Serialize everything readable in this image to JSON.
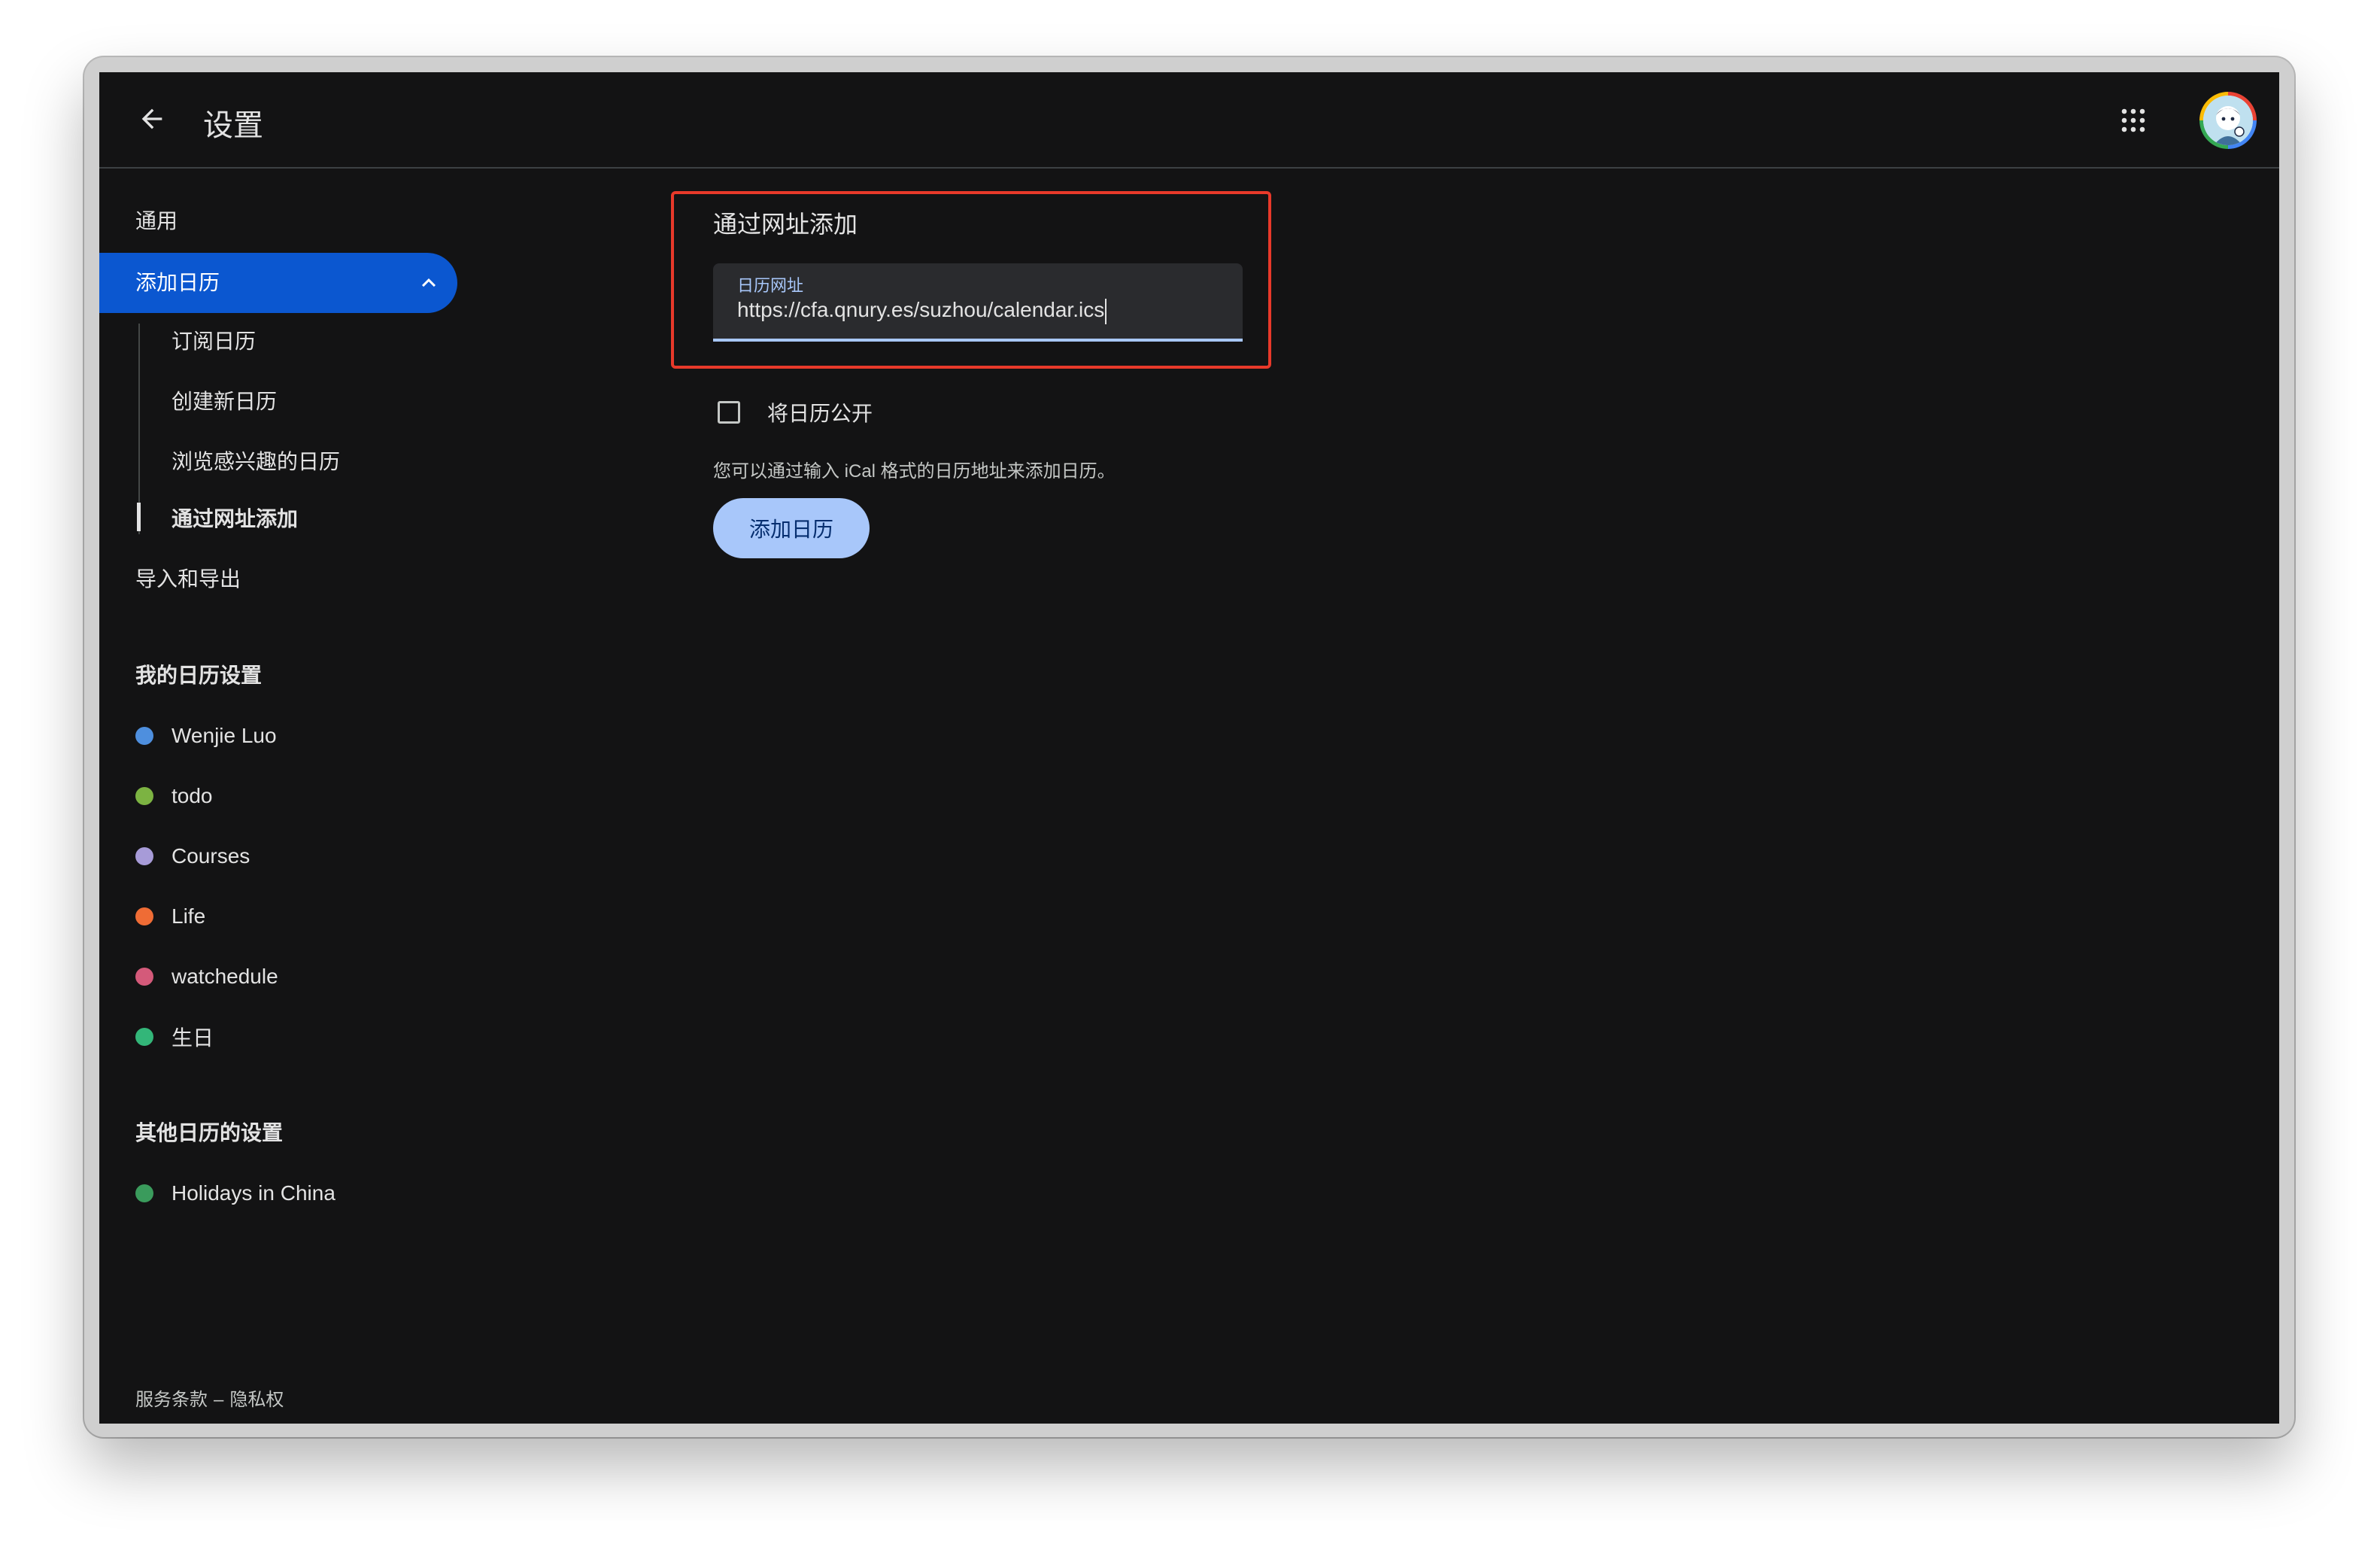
{
  "header": {
    "title": "设置",
    "back_icon": "arrow-back-icon",
    "apps_icon": "apps-grid-icon",
    "avatar_icon": "account-avatar"
  },
  "sidebar": {
    "general": "通用",
    "add_calendar": {
      "label": "添加日历",
      "expanded": true,
      "children": [
        "订阅日历",
        "创建新日历",
        "浏览感兴趣的日历",
        "通过网址添加"
      ],
      "active_child": "通过网址添加"
    },
    "import_export": "导入和导出",
    "my_calendars_heading": "我的日历设置",
    "my_calendars": [
      {
        "label": "Wenjie Luo",
        "color": "#4e8fde"
      },
      {
        "label": "todo",
        "color": "#7cb342"
      },
      {
        "label": "Courses",
        "color": "#a79bd8"
      },
      {
        "label": "Life",
        "color": "#ef6c35"
      },
      {
        "label": "watchedule",
        "color": "#d45a7a"
      },
      {
        "label": "生日",
        "color": "#33b679"
      }
    ],
    "other_calendars_heading": "其他日历的设置",
    "other_calendars": [
      {
        "label": "Holidays in China",
        "color": "#3a9b5c"
      }
    ],
    "footer": {
      "terms": "服务条款",
      "separator": "–",
      "privacy": "隐私权"
    }
  },
  "main": {
    "section_title": "通过网址添加",
    "url_field": {
      "label": "日历网址",
      "value": "https://cfa.qnury.es/suzhou/calendar.ics"
    },
    "public_checkbox": {
      "label": "将日历公开",
      "checked": false
    },
    "help_text": "您可以通过输入 iCal 格式的日历地址来添加日历。",
    "add_button": "添加日历"
  },
  "colors": {
    "background": "#131314",
    "active_nav": "#0b57d0",
    "primary_button": "#a8c7fa",
    "highlight_border": "#e8392a"
  }
}
